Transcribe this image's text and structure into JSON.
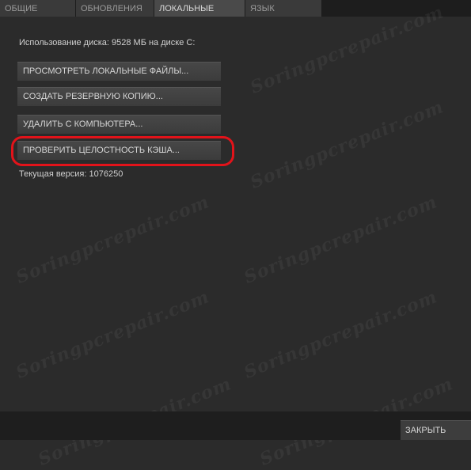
{
  "tabs": [
    {
      "label": "ОБЩИЕ",
      "active": false
    },
    {
      "label": "ОБНОВЛЕНИЯ",
      "active": false
    },
    {
      "label": "ЛОКАЛЬНЫЕ ФАЙЛЫ",
      "active": true
    },
    {
      "label": "ЯЗЫК",
      "active": false
    }
  ],
  "local_files": {
    "disk_usage_text": "Использование диска: 9528 МБ на диске С:",
    "browse_button": "ПРОСМОТРЕТЬ ЛОКАЛЬНЫЕ ФАЙЛЫ...",
    "backup_button": "СОЗДАТЬ РЕЗЕРВНУЮ КОПИЮ...",
    "delete_button": "УДАЛИТЬ С КОМПЬЮТЕРА...",
    "verify_button": "ПРОВЕРИТЬ ЦЕЛОСТНОСТЬ КЭША...",
    "current_version_text": "Текущая версия: 1076250"
  },
  "footer": {
    "close_button": "ЗАКРЫТЬ"
  },
  "watermark": {
    "text": "Soringpcrepair.com"
  },
  "colors": {
    "highlight": "#e2131a",
    "background": "#2b2b2b",
    "active_tab": "#4a4a4a"
  }
}
